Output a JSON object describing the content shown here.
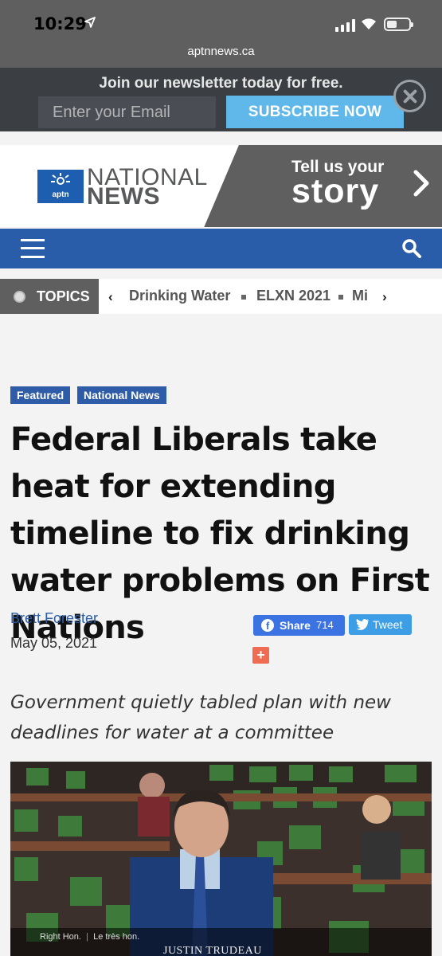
{
  "status": {
    "time": "10:29",
    "url": "aptnnews.ca"
  },
  "newsletter": {
    "text": "Join our newsletter today for free.",
    "email_placeholder": "Enter your Email",
    "subscribe_label": "SUBSCRIBE NOW"
  },
  "header": {
    "logo_small": "aptn",
    "logo_line1": "NATIONAL",
    "logo_line2": "NEWS",
    "cta_line1": "Tell us your",
    "cta_line2": "story"
  },
  "topics": {
    "label": "TOPICS",
    "items": [
      "Drinking Water",
      "ELXN 2021",
      "Mi"
    ]
  },
  "article": {
    "tags": [
      "Featured",
      "National News"
    ],
    "headline": "Federal Liberals take heat for extending timeline to fix drinking water problems on First Nations",
    "author": "Brett Forester",
    "date": "May 05, 2021",
    "share_label": "Share",
    "share_count": "714",
    "tweet_label": "Tweet",
    "plus_label": "+",
    "subhead": "Government quietly tabled plan with new deadlines for water at a committee"
  },
  "photo": {
    "caption_title": "Right Hon.",
    "caption_fr": "Le très hon.",
    "caption_name": "JUSTIN TRUDEAU"
  },
  "colors": {
    "brand_blue": "#2a5da9",
    "header_gray": "#5f5f5f",
    "subscribe_blue": "#5fb7ea",
    "share_blue": "#3b73e3",
    "tweet_blue": "#3d9ee6"
  }
}
